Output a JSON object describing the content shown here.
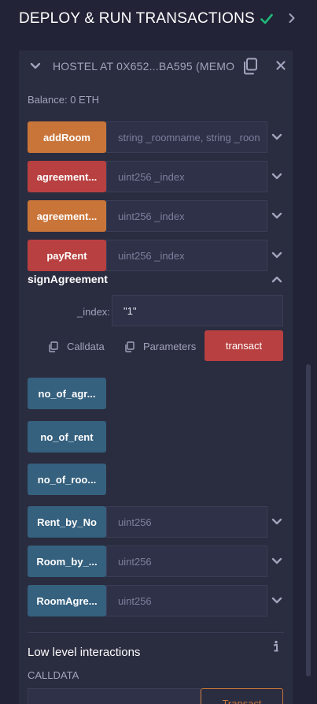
{
  "header": {
    "title": "DEPLOY & RUN TRANSACTIONS"
  },
  "instance": {
    "name": "HOSTEL AT 0X652...BA595 (MEMO",
    "balance": "Balance: 0 ETH"
  },
  "functions": [
    {
      "label": "addRoom",
      "placeholder": "string _roomname, string _roon",
      "color": "#c97539"
    },
    {
      "label": "agreement...",
      "placeholder": "uint256 _index",
      "color": "#b84040"
    },
    {
      "label": "agreement...",
      "placeholder": "uint256 _index",
      "color": "#c97539"
    },
    {
      "label": "payRent",
      "placeholder": "uint256 _index",
      "color": "#b84040"
    }
  ],
  "signAgreement": {
    "title": "signAgreement",
    "param_label": "_index:",
    "param_value": "\"1\"",
    "calldata_label": "Calldata",
    "parameters_label": "Parameters",
    "transact_label": "transact"
  },
  "getters": [
    {
      "label": "no_of_agr..."
    },
    {
      "label": "no_of_rent"
    },
    {
      "label": "no_of_roo..."
    }
  ],
  "mappings": [
    {
      "label": "Rent_by_No",
      "placeholder": "uint256"
    },
    {
      "label": "Room_by_...",
      "placeholder": "uint256"
    },
    {
      "label": "RoomAgre...",
      "placeholder": "uint256"
    }
  ],
  "lowLevel": {
    "title": "Low level interactions",
    "calldata_label": "CALLDATA",
    "transact_label": "Transact"
  },
  "colors": {
    "background": "#222336",
    "panel": "#2a2c3f",
    "transact_orange": "#c97539",
    "payable_red": "#b84040",
    "call_blue": "#35607e",
    "check_green": "#1fb978"
  }
}
